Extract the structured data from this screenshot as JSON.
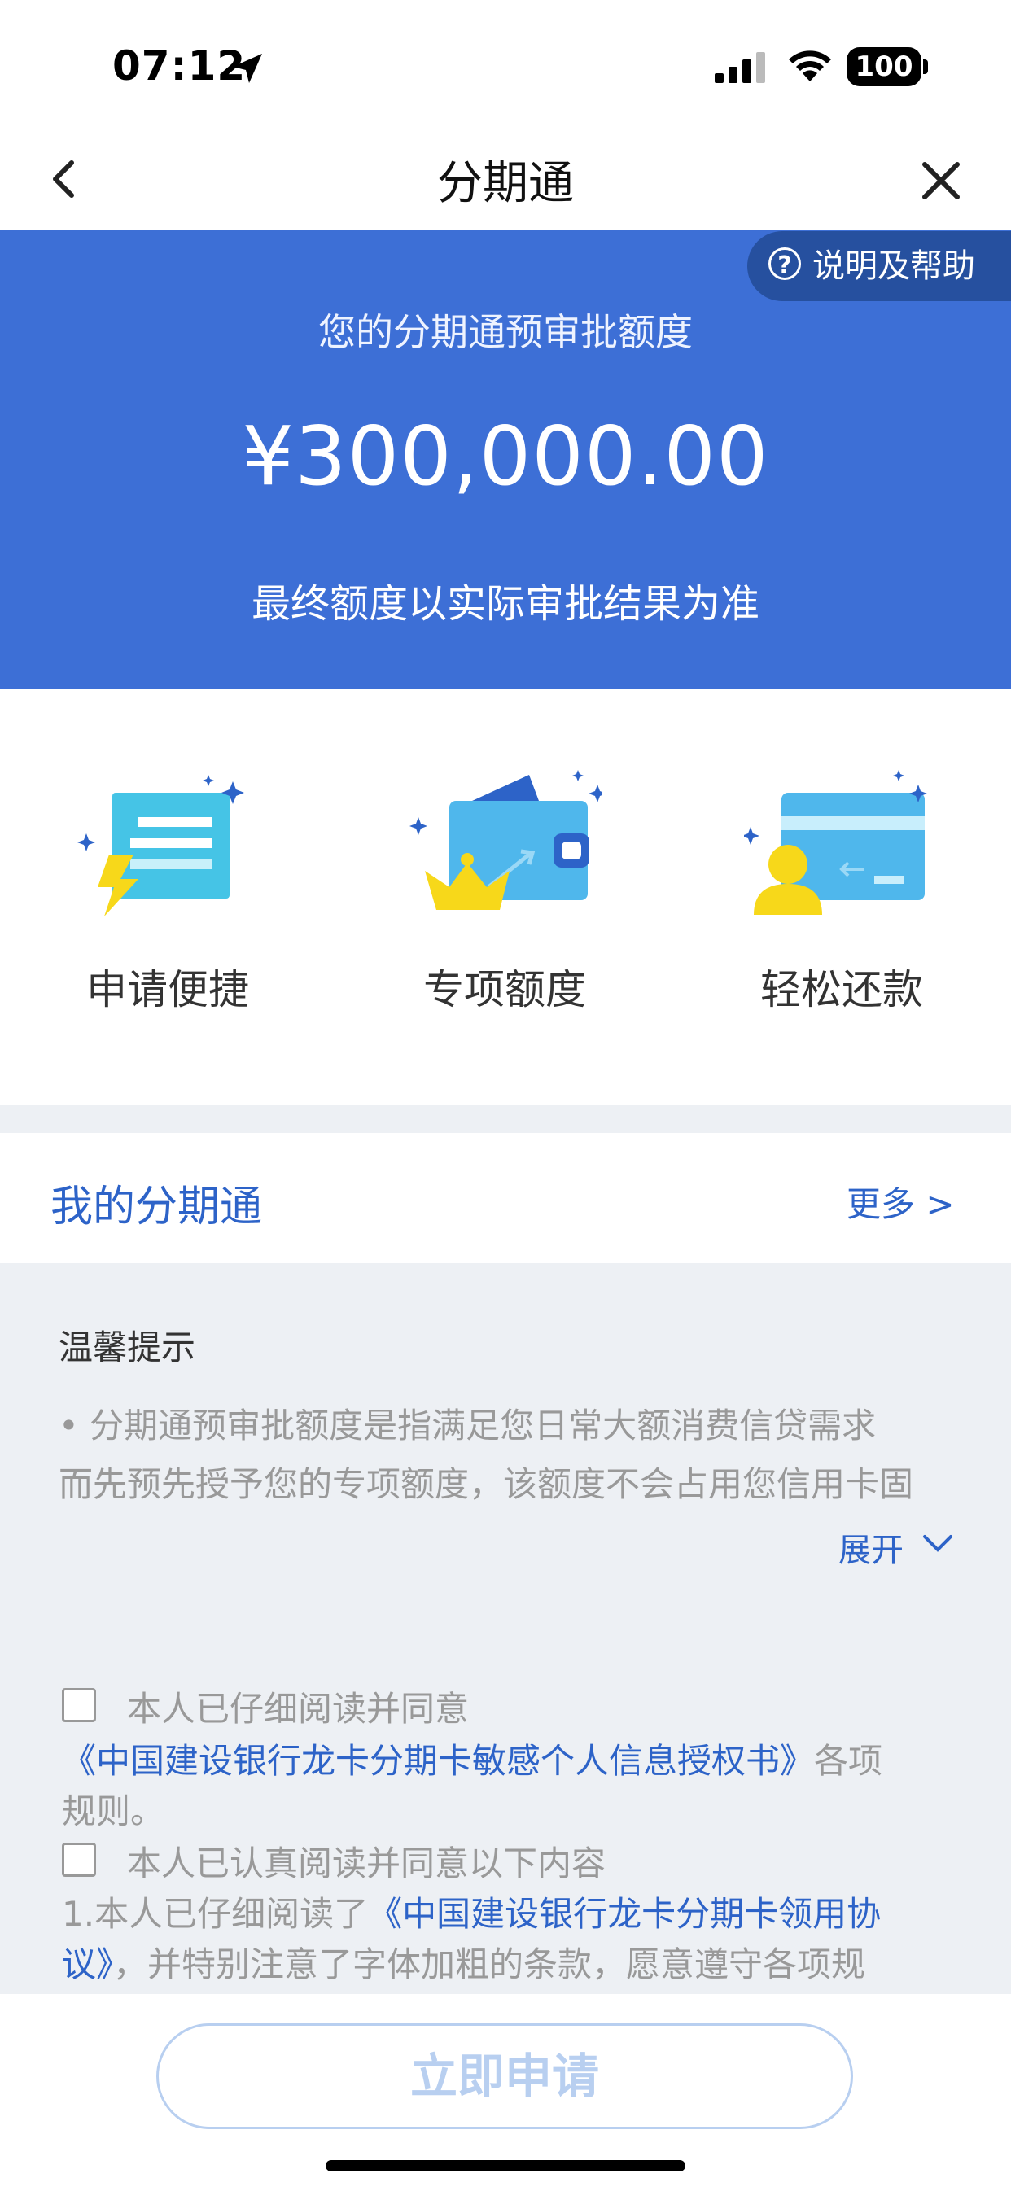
{
  "status_bar": {
    "time": "07:12",
    "battery": "100"
  },
  "nav": {
    "title": "分期通"
  },
  "hero": {
    "help_label": "说明及帮助",
    "label": "您的分期通预审批额度",
    "amount": "¥300,000.00",
    "note": "最终额度以实际审批结果为准"
  },
  "features": [
    {
      "label": "申请便捷",
      "icon": "receipt-lightning-icon"
    },
    {
      "label": "专项额度",
      "icon": "wallet-crown-icon"
    },
    {
      "label": "轻松还款",
      "icon": "card-user-icon"
    }
  ],
  "my_section": {
    "title": "我的分期通",
    "more": "更多 >"
  },
  "tips": {
    "title": "温馨提示",
    "line1": "• 分期通预审批额度是指满足您日常大额消费信贷需求",
    "line2": "而先预先授予您的专项额度，该额度不会占用您信用卡固",
    "expand": "展开"
  },
  "agreements": {
    "a1_text": "本人已仔细阅读并同意",
    "a1_link": "《中国建设银行龙卡分期卡敏感个人信息授权书》",
    "a1_suffix": "各项",
    "a1_line3": "规则。",
    "a2_text": "本人已认真阅读并同意以下内容",
    "a2_line2_prefix": "1.本人已仔细阅读了",
    "a2_line2_link": "《中国建设银行龙卡分期卡领用协",
    "a2_line3_link": "议》",
    "a2_line3_suffix": "，并特别注意了字体加粗的条款，愿意遵守各项规"
  },
  "bottom": {
    "apply": "立即申请"
  },
  "colors": {
    "brand_blue": "#3d6fd6",
    "link_blue": "#2d63c8",
    "disabled_button": "#b8cff0"
  }
}
